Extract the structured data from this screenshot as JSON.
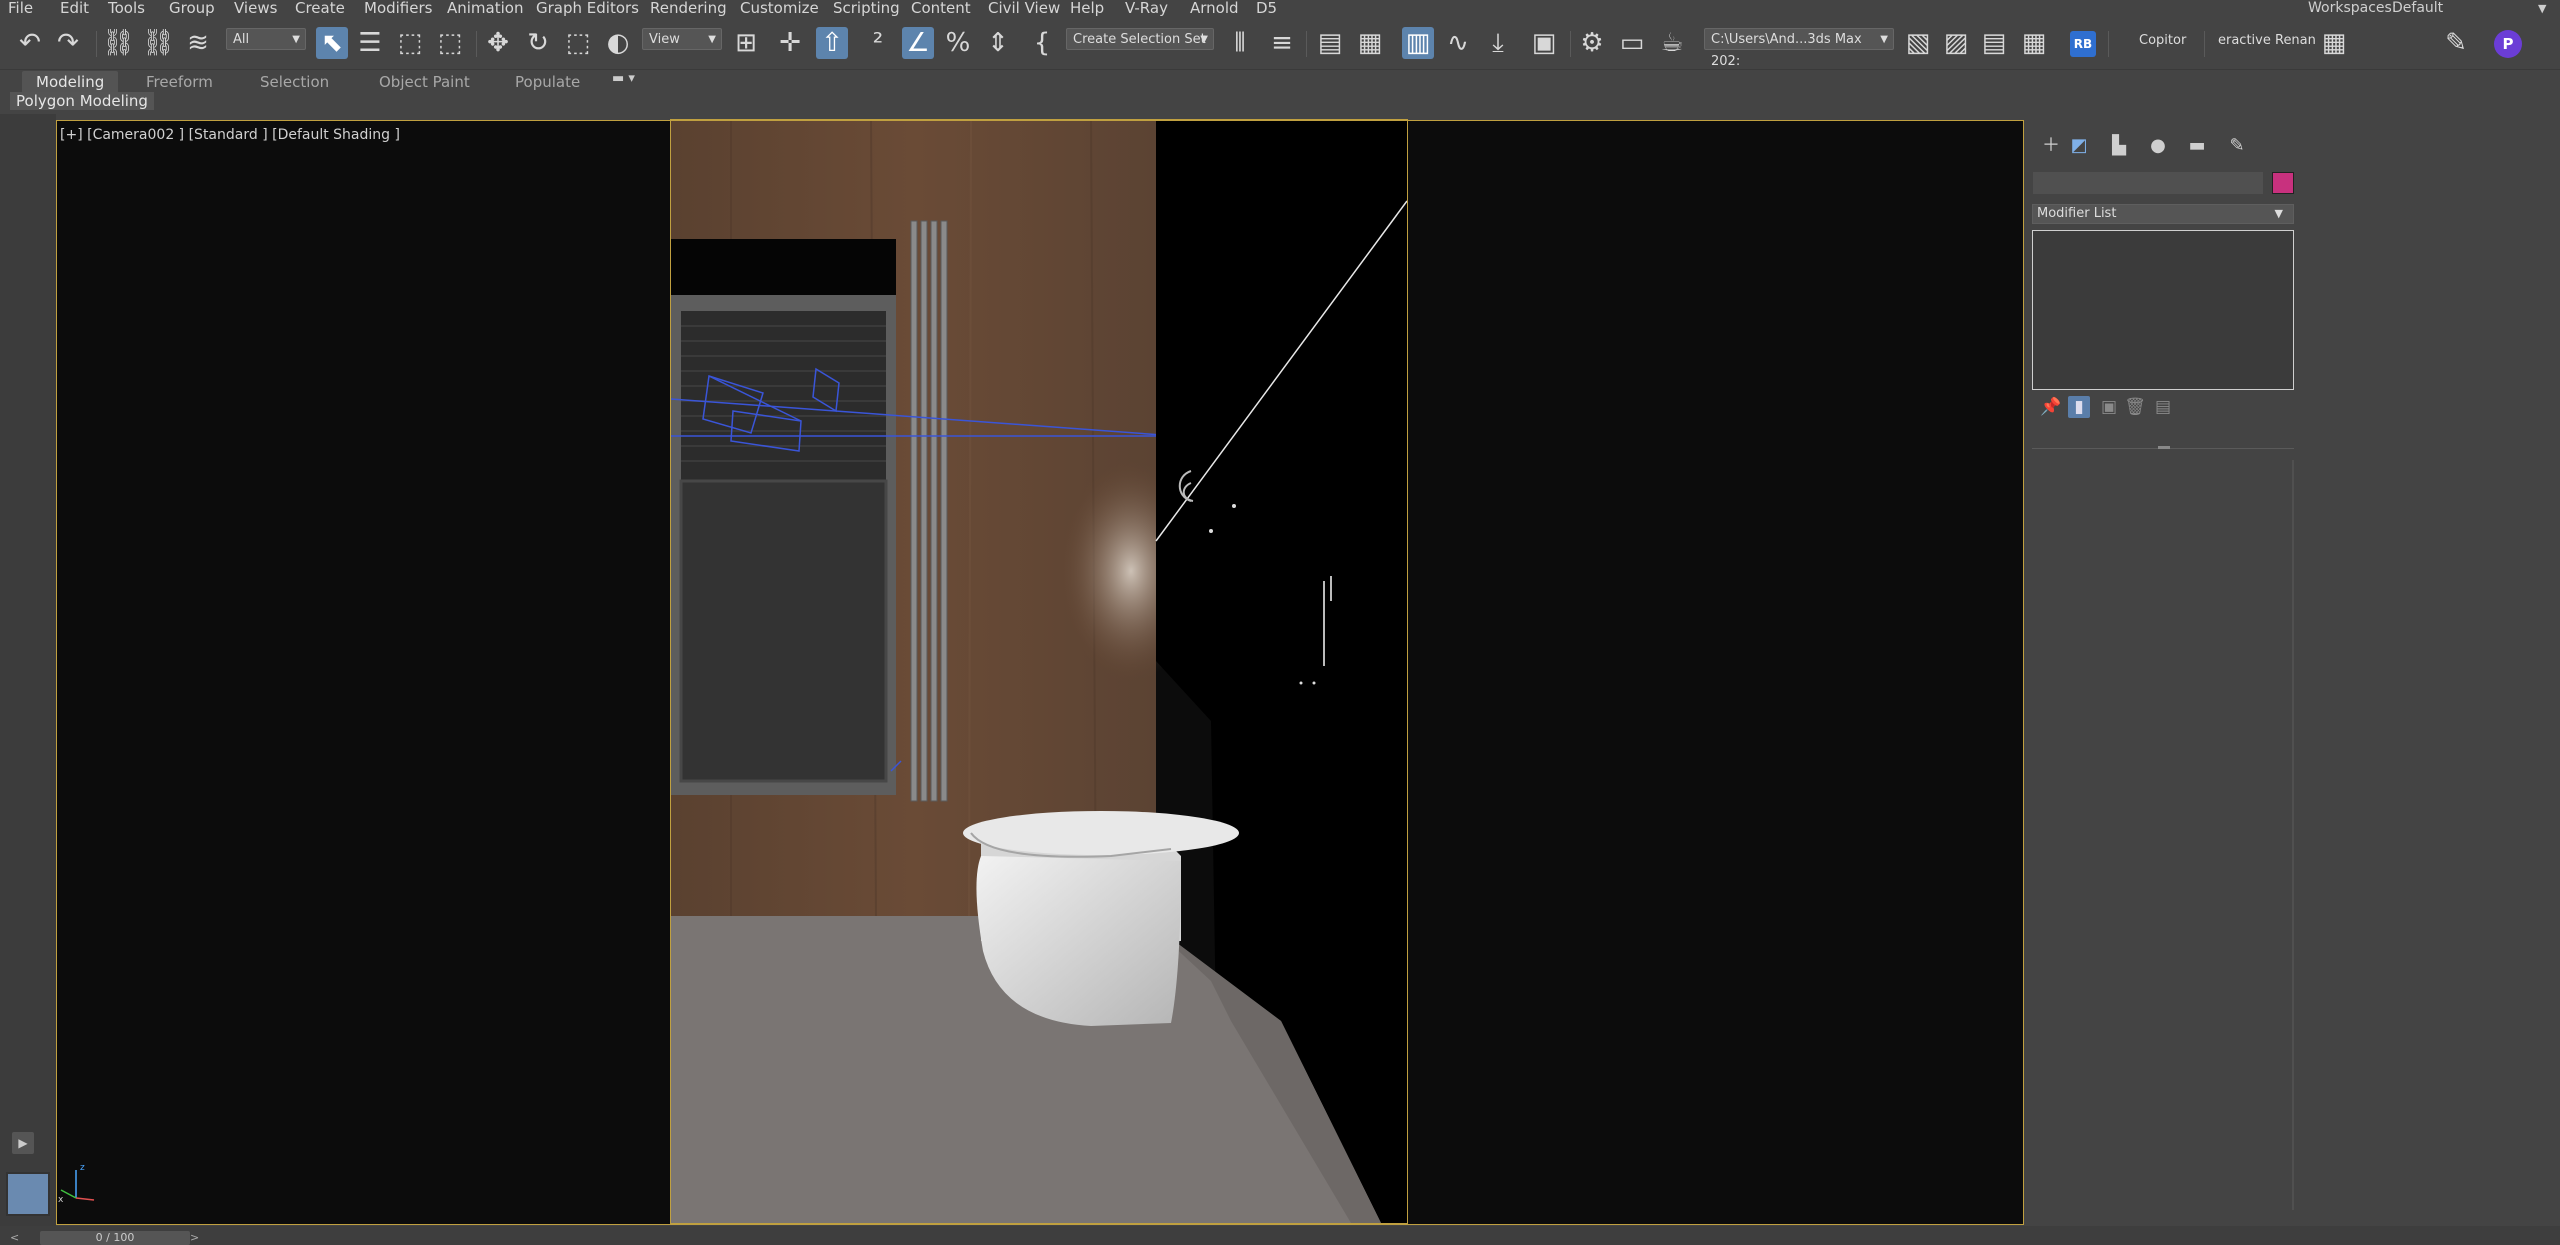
{
  "menu": [
    "File",
    "Edit",
    "Tools",
    "Group",
    "Views",
    "Create",
    "Modifiers",
    "Animation",
    "Graph Editors",
    "Rendering",
    "Customize",
    "Scripting",
    "Content",
    "Civil View",
    "Help",
    "V-Ray",
    "Arnold",
    "D5"
  ],
  "workspace": {
    "label": "Workspaces:",
    "value": "Default"
  },
  "toolbar": {
    "selection_filter": "All",
    "ref_coord": "View",
    "selection_set": "Create Selection Set",
    "project_path": "C:\\Users\\And...3ds Max 202:",
    "rb_label": "RB",
    "copitor_label": "Copitor",
    "interactive_label": "eractive Renan",
    "profile_initial": "P"
  },
  "ribbon": {
    "tabs": [
      "Modeling",
      "Freeform",
      "Selection",
      "Object Paint",
      "Populate"
    ],
    "active_tab": "Modeling",
    "sub_panel": "Polygon Modeling"
  },
  "viewport": {
    "label": "[+] [Camera002 ] [Standard ] [Default Shading ]",
    "axis_x": "x",
    "axis_z": "z"
  },
  "command_panel": {
    "name_value": "",
    "modifier_list": "Modifier List",
    "object_color": "#c8317e"
  },
  "timeline": {
    "frame": "0 / 100"
  },
  "icons": [
    "undo-icon",
    "redo-icon",
    "link-icon",
    "unlink-icon",
    "bind-space-warp-icon",
    "select-object-icon",
    "select-by-name-icon",
    "rect-selection-icon",
    "window-crossing-icon",
    "move-icon",
    "rotate-icon",
    "scale-icon",
    "placement-icon",
    "snaps-toggle-icon",
    "angle-snap-icon",
    "percent-snap-icon",
    "spinner-snap-icon",
    "named-selection-icon",
    "mirror-icon",
    "align-icon",
    "scene-explorer-icon",
    "layer-explorer-icon",
    "ribbon-toggle-icon",
    "curve-editor-icon",
    "schematic-view-icon",
    "material-editor-icon",
    "render-setup-icon",
    "rendered-frame-window-icon",
    "render-production-icon"
  ]
}
